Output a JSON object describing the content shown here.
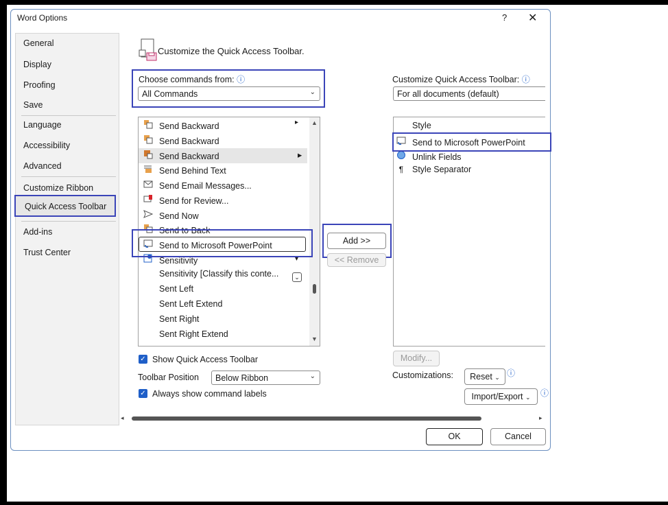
{
  "window": {
    "title": "Word Options",
    "help": "?",
    "close": "✕"
  },
  "nav": {
    "items": [
      {
        "label": "General"
      },
      {
        "label": "Display"
      },
      {
        "label": "Proofing"
      },
      {
        "label": "Save"
      },
      {
        "label": "Language"
      },
      {
        "label": "Accessibility"
      },
      {
        "label": "Advanced"
      },
      {
        "label": "Customize Ribbon"
      },
      {
        "label": "Quick Access Toolbar"
      },
      {
        "label": "Add-ins"
      },
      {
        "label": "Trust Center"
      }
    ],
    "selected": "Quick Access Toolbar"
  },
  "header": {
    "text": "Customize the Quick Access Toolbar."
  },
  "left": {
    "choose_label": "Choose commands from:",
    "choose_value": "All Commands",
    "commands": [
      {
        "label": "Send Backward",
        "icon": "send-backward-icon",
        "submenu": true
      },
      {
        "label": "Send Backward",
        "icon": "send-backward-icon",
        "submenu": false
      },
      {
        "label": "Send Backward",
        "icon": "send-backward-icon",
        "submenu": true
      },
      {
        "label": "Send Behind Text",
        "icon": "behind-text-icon",
        "submenu": false
      },
      {
        "label": "Send Email Messages...",
        "icon": "email-icon",
        "submenu": false
      },
      {
        "label": "Send for Review...",
        "icon": "review-icon",
        "submenu": false
      },
      {
        "label": "Send Now",
        "icon": "send-now-icon",
        "submenu": false
      },
      {
        "label": "Send to Back",
        "icon": "send-to-back-icon",
        "submenu": false
      },
      {
        "label": "Send to Microsoft PowerPoint",
        "icon": "powerpoint-icon",
        "submenu": false
      },
      {
        "label": "Sensitivity",
        "icon": "sensitivity-icon",
        "submenu": false
      },
      {
        "label": "Sensitivity [Classify this conte...",
        "icon": "",
        "submenu": false
      },
      {
        "label": "Sent Left",
        "icon": "",
        "submenu": false
      },
      {
        "label": "Sent Left Extend",
        "icon": "",
        "submenu": false
      },
      {
        "label": "Sent Right",
        "icon": "",
        "submenu": false
      },
      {
        "label": "Sent Right Extend",
        "icon": "",
        "submenu": false
      }
    ],
    "show_toolbar_label": "Show Quick Access Toolbar",
    "toolbar_position_label": "Toolbar Position",
    "toolbar_position_value": "Below Ribbon",
    "always_show_labels_label": "Always show command labels"
  },
  "middle": {
    "add_label": "Add >>",
    "remove_label": "<< Remove"
  },
  "right": {
    "customize_label": "Customize Quick Access Toolbar:",
    "customize_value": "For all documents (default)",
    "items": [
      {
        "label": "Style",
        "icon": ""
      },
      {
        "label": "Send to Microsoft PowerPoint",
        "icon": "powerpoint-icon"
      },
      {
        "label": "Unlink Fields",
        "icon": "unlink-fields-icon"
      },
      {
        "label": "Style Separator",
        "icon": "pilcrow-icon"
      }
    ],
    "modify_label": "Modify...",
    "customizations_label": "Customizations:",
    "reset_label": "Reset",
    "import_export_label": "Import/Export"
  },
  "footer": {
    "ok_label": "OK",
    "cancel_label": "Cancel"
  },
  "colors": {
    "accent": "#1f5fc8",
    "highlight": "#3a44b8"
  }
}
